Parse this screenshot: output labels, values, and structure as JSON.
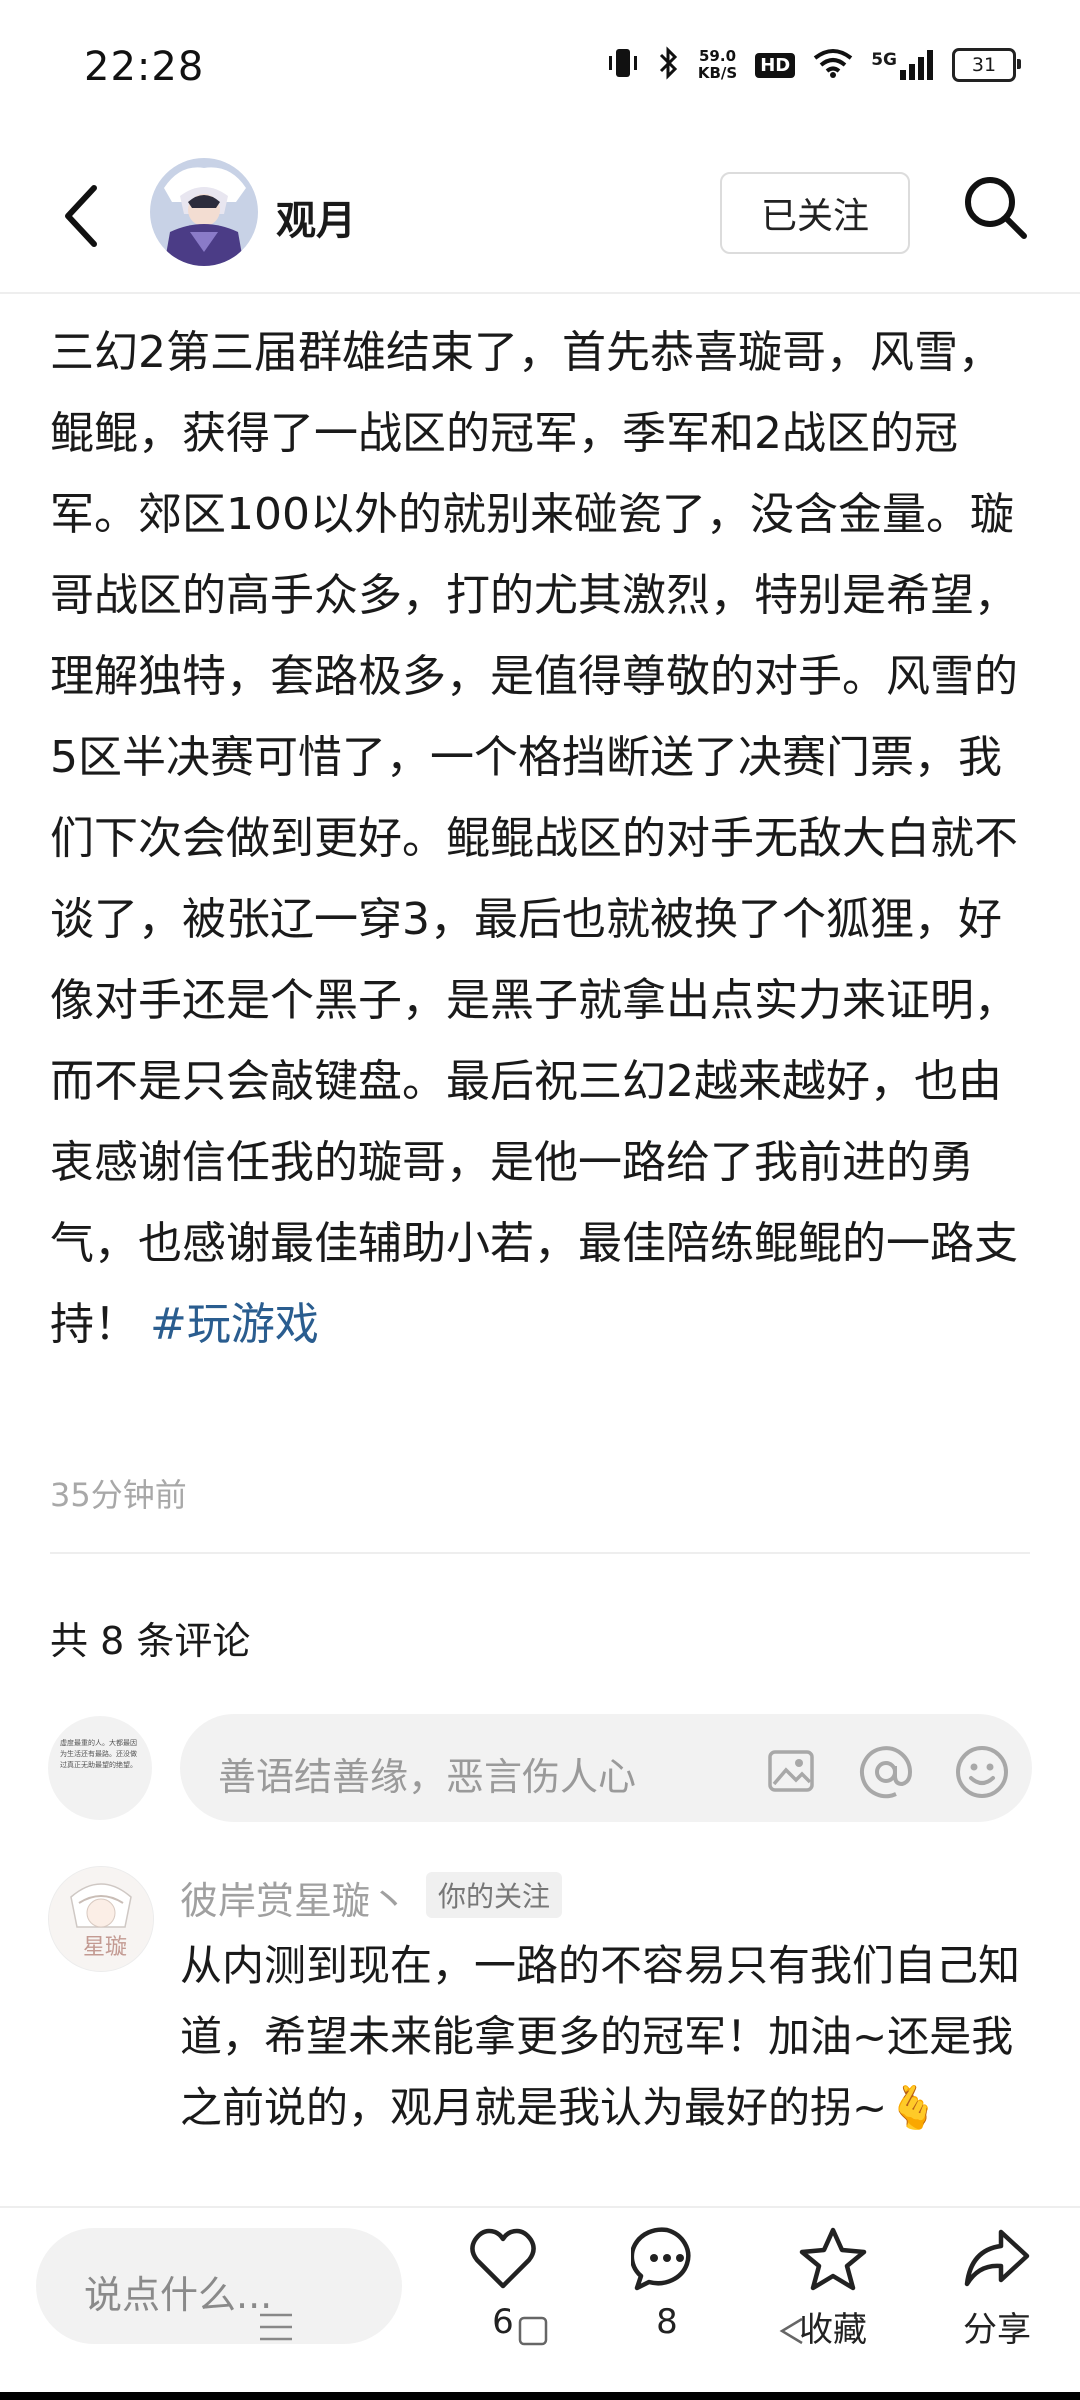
{
  "status_bar": {
    "time": "22:28",
    "net_speed_value": "59.0",
    "net_speed_unit": "KB/S",
    "hd": "HD",
    "signal": "5G",
    "battery": "31"
  },
  "header": {
    "username": "观月",
    "follow_label": "已关注"
  },
  "post": {
    "body": "三幻2第三届群雄结束了，首先恭喜璇哥，风雪，鲲鲲，获得了一战区的冠军，季军和2战区的冠军。郊区100以外的就别来碰瓷了，没含金量。璇哥战区的高手众多，打的尤其激烈，特别是希望，理解独特，套路极多，是值得尊敬的对手。风雪的5区半决赛可惜了，一个格挡断送了决赛门票，我们下次会做到更好。鲲鲲战区的对手无敌大白就不谈了，被张辽一穿3，最后也就被换了个狐狸，好像对手还是个黑子，是黑子就拿出点实力来证明，而不是只会敲键盘。最后祝三幻2越来越好，也由衷感谢信任我的璇哥，是他一路给了我前进的勇气，也感谢最佳辅助小若，最佳陪练鲲鲲的一路支持！",
    "tag": "#玩游戏",
    "time": "35分钟前"
  },
  "comments": {
    "count_label": "共 8 条评论",
    "input_placeholder": "善语结善缘，恶言伤人心",
    "my_avatar_text": "虚度最重的人。大都最因为生活还有最路。还没做过真正无助最望的绝望。",
    "items": [
      {
        "author": "彼岸赏星璇丶",
        "badge": "你的关注",
        "text": "从内测到现在，一路的不容易只有我们自己知道，希望未来能拿更多的冠军！加油~还是我之前说的，观月就是我认为最好的拐~",
        "emoji": "🫰",
        "avatar_text": "星璇"
      }
    ]
  },
  "bottom_bar": {
    "input_placeholder": "说点什么...",
    "like_count": "6",
    "comment_count": "8",
    "favorite_label": "收藏",
    "share_label": "分享"
  },
  "colors": {
    "tag": "#2a5d8f",
    "muted": "#a8a8a8",
    "input_bg": "#f2f2f2"
  }
}
